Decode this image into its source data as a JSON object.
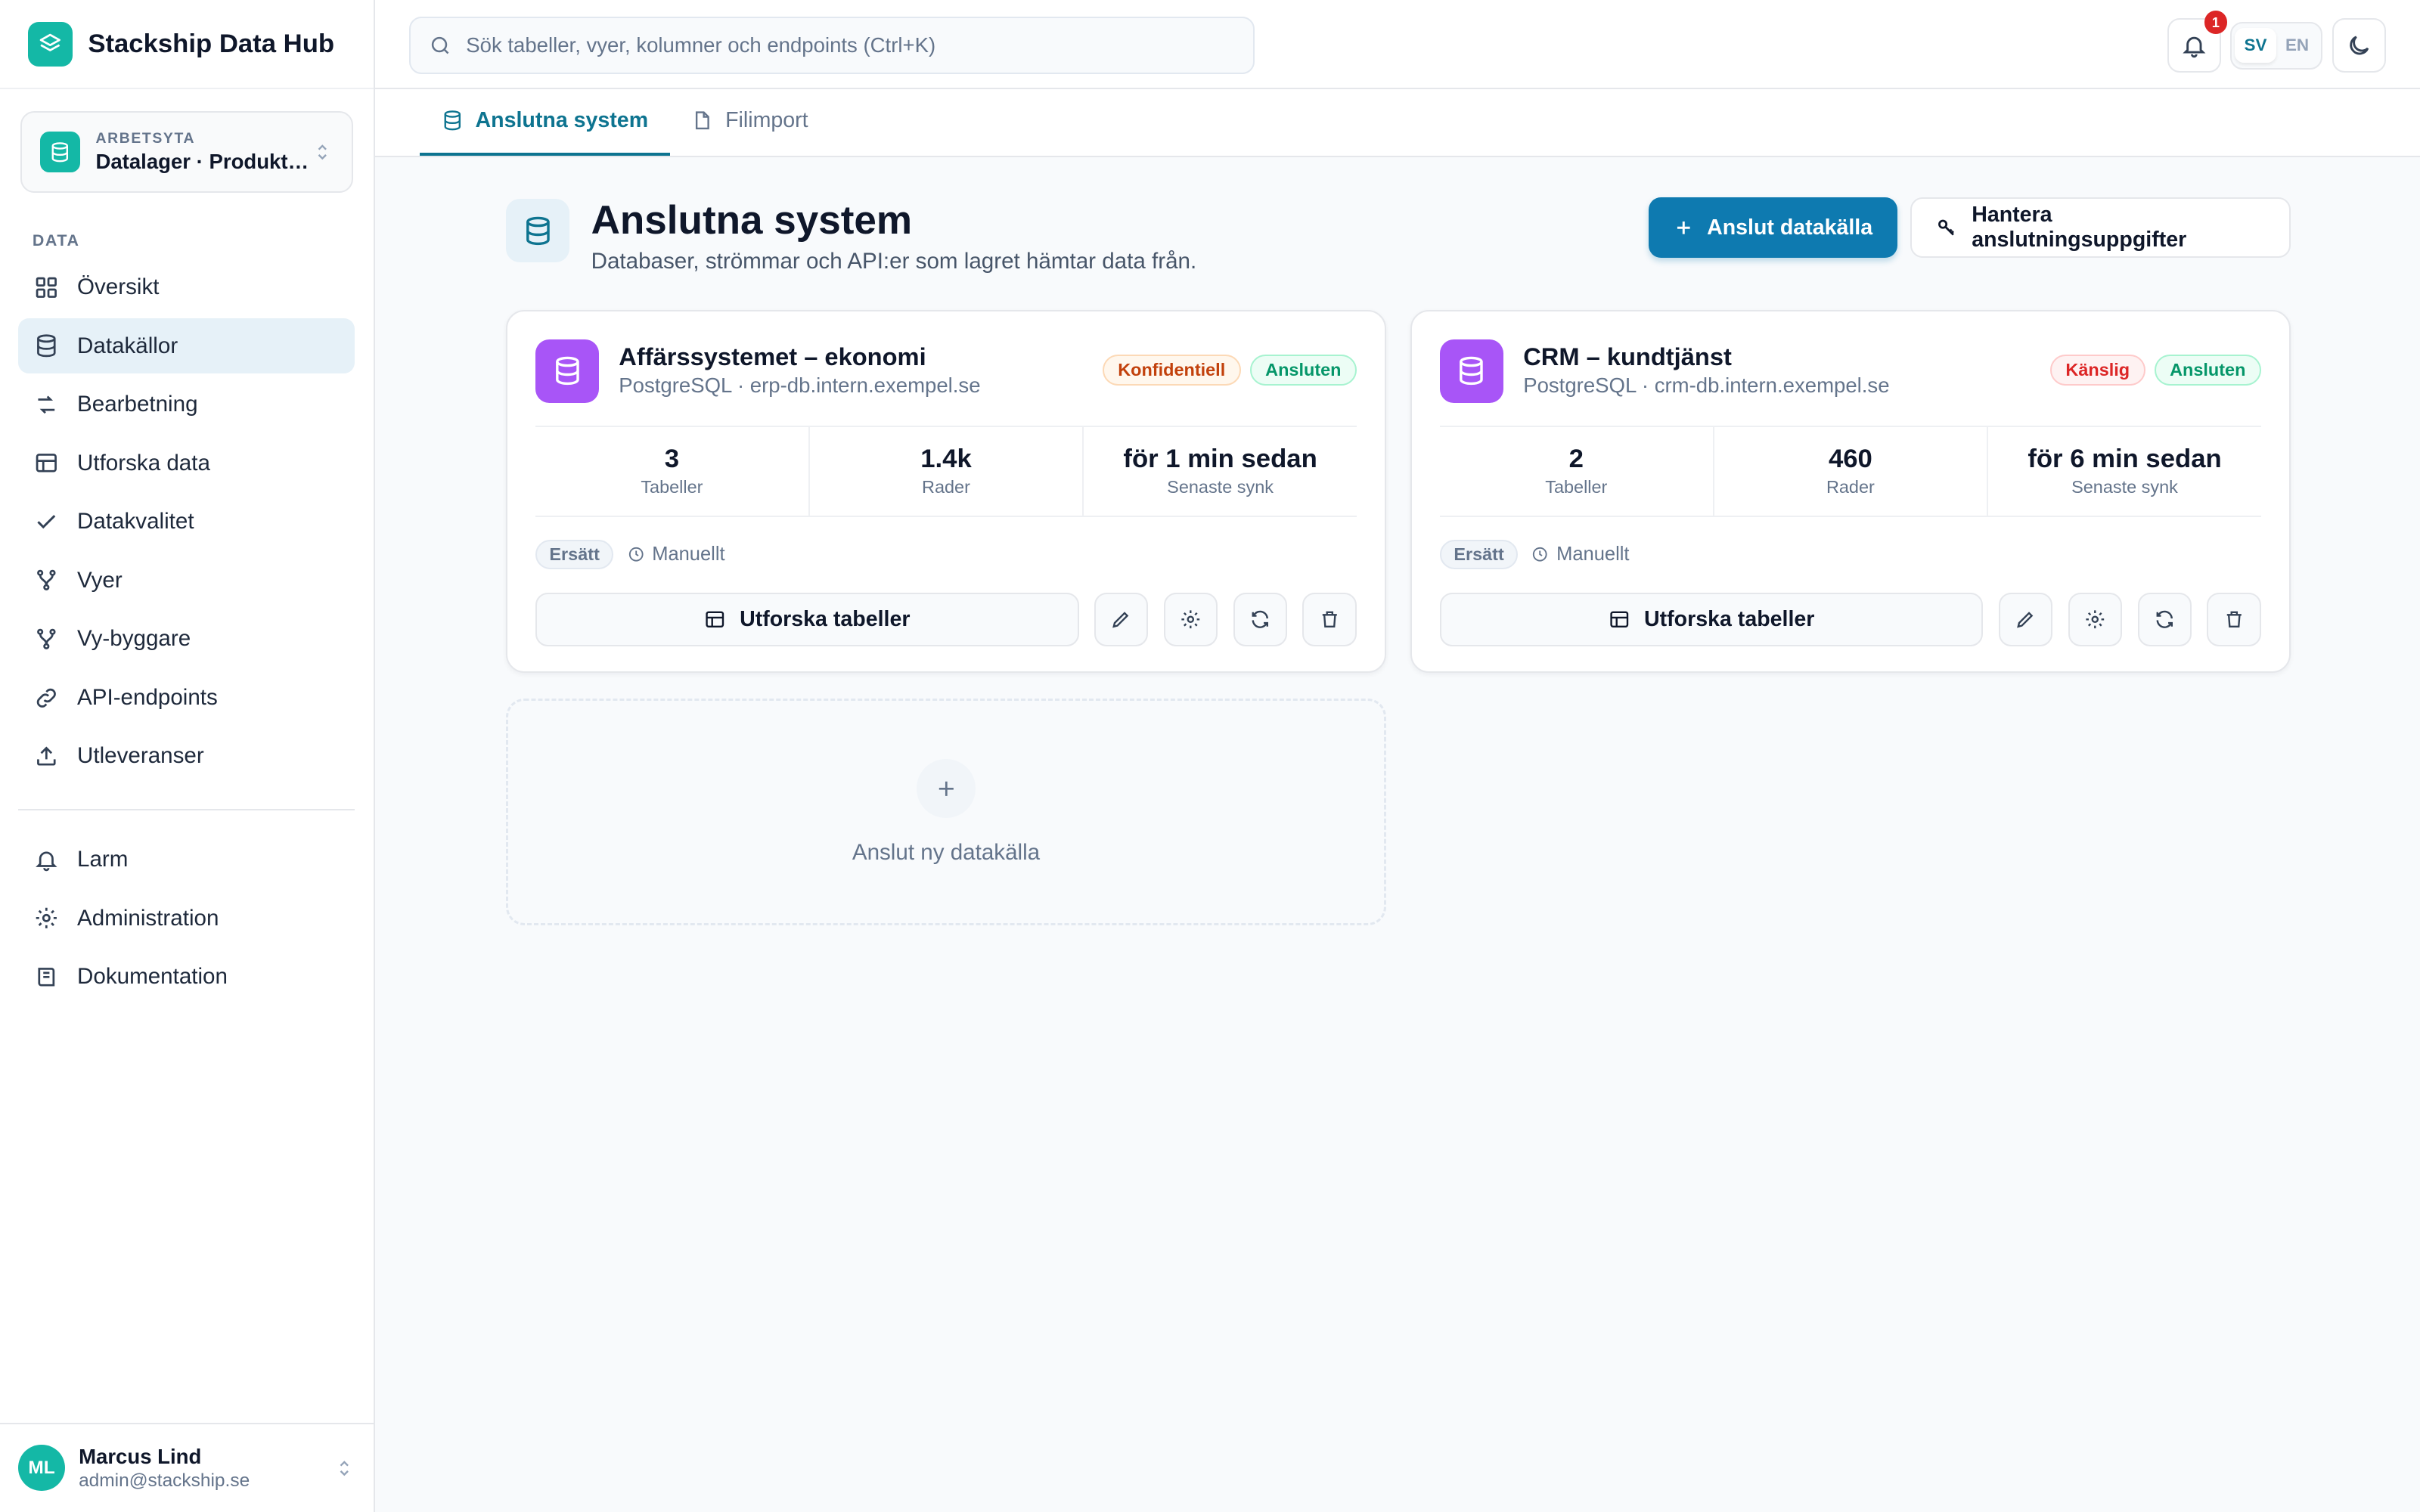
{
  "app": {
    "name": "Stackship Data Hub"
  },
  "workspace": {
    "label": "ARBETSYTA",
    "name": "Datalager · Produktion"
  },
  "sidebar": {
    "section_label": "DATA",
    "items": [
      {
        "label": "Översikt",
        "icon": "grid-icon"
      },
      {
        "label": "Datakällor",
        "icon": "database-icon",
        "active": true
      },
      {
        "label": "Bearbetning",
        "icon": "transform-icon"
      },
      {
        "label": "Utforska data",
        "icon": "table-icon"
      },
      {
        "label": "Datakvalitet",
        "icon": "check-icon"
      },
      {
        "label": "Vyer",
        "icon": "branch-icon"
      },
      {
        "label": "Vy-byggare",
        "icon": "branch-icon"
      },
      {
        "label": "API-endpoints",
        "icon": "link-icon"
      },
      {
        "label": "Utleveranser",
        "icon": "upload-icon"
      }
    ],
    "secondary_items": [
      {
        "label": "Larm",
        "icon": "bell-icon"
      },
      {
        "label": "Administration",
        "icon": "gear-icon"
      },
      {
        "label": "Dokumentation",
        "icon": "book-icon"
      }
    ]
  },
  "user": {
    "initials": "ML",
    "name": "Marcus Lind",
    "email": "admin@stackship.se"
  },
  "search": {
    "placeholder": "Sök tabeller, vyer, kolumner och endpoints (Ctrl+K)"
  },
  "topbar": {
    "notification_count": "1",
    "lang_sv": "SV",
    "lang_en": "EN"
  },
  "tabs": [
    {
      "label": "Anslutna system",
      "active": true
    },
    {
      "label": "Filimport",
      "active": false
    }
  ],
  "page": {
    "title": "Anslutna system",
    "subtitle": "Databaser, strömmar och API:er som lagret hämtar data från.",
    "primary_action": "Anslut datakälla",
    "secondary_action": "Hantera anslutningsuppgifter"
  },
  "sources": [
    {
      "name": "Affärssystemet – ekonomi",
      "subtitle": "PostgreSQL · erp-db.intern.exempel.se",
      "classification": "Konfidentiell",
      "status": "Ansluten",
      "stats": [
        {
          "value": "3",
          "label": "Tabeller"
        },
        {
          "value": "1.4k",
          "label": "Rader"
        },
        {
          "value": "för 1 min sedan",
          "label": "Senaste synk"
        }
      ],
      "mode_tag": "Ersätt",
      "schedule": "Manuellt",
      "explore_label": "Utforska tabeller"
    },
    {
      "name": "CRM – kundtjänst",
      "subtitle": "PostgreSQL · crm-db.intern.exempel.se",
      "classification": "Känslig",
      "status": "Ansluten",
      "stats": [
        {
          "value": "2",
          "label": "Tabeller"
        },
        {
          "value": "460",
          "label": "Rader"
        },
        {
          "value": "för 6 min sedan",
          "label": "Senaste synk"
        }
      ],
      "mode_tag": "Ersätt",
      "schedule": "Manuellt",
      "explore_label": "Utforska tabeller"
    }
  ],
  "add_source": {
    "label": "Anslut ny datakälla"
  },
  "colors": {
    "accent": "#0e7ab0",
    "brand": "#14b8a6",
    "source_icon": "#a855f7"
  }
}
